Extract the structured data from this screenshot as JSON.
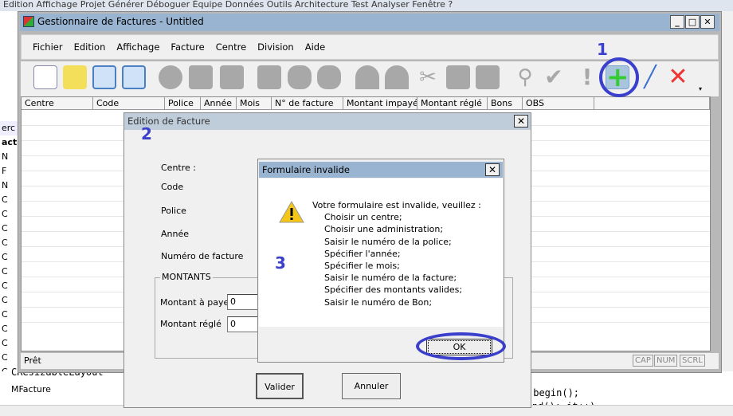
{
  "ide": {
    "top_menu": "Edition   Affichage   Projet   Générer   Déboguer   Équipe   Données   Outils   Architecture   Test   Analyser   Fenêtre   ?",
    "left_items": [
      "erc",
      "act",
      "N",
      "F",
      "N",
      "C",
      "C",
      "C",
      "C",
      "C",
      "C",
      "C",
      "C",
      "C",
      "C",
      "C",
      "C",
      "C"
    ],
    "tree_items": [
      "CResizableLayout",
      "MFacture"
    ],
    "code_lines": [
      ".begin();",
      "it!=DbDoc->m_listFacture.end(); it++)"
    ]
  },
  "main_window": {
    "title": "Gestionnaire de Factures - Untitled",
    "controls": {
      "minimize": "_",
      "maximize": "□",
      "close": "✕"
    },
    "menu": [
      "Fichier",
      "Edition",
      "Affichage",
      "Facture",
      "Centre",
      "Division",
      "Aide"
    ],
    "toolbar": [
      "new-document",
      "open-folder",
      "save",
      "save-as",
      "disabled",
      "disabled",
      "disabled",
      "disabled",
      "disabled",
      "disabled",
      "undo",
      "redo",
      "cut",
      "copy",
      "paste",
      "search",
      "check",
      "info",
      "add",
      "edit",
      "delete"
    ],
    "columns": [
      "Centre",
      "Code",
      "Police",
      "Année",
      "Mois",
      "N° de facture",
      "Montant impayé",
      "Montant réglé",
      "Bons",
      "OBS",
      ""
    ],
    "status": "Prêt",
    "indicators": [
      "CAP",
      "NUM",
      "SCRL"
    ]
  },
  "edit_dialog": {
    "title": "Edition de Facture",
    "fields": [
      "Centre :",
      "Code",
      "Police",
      "Année",
      "Numéro de facture"
    ],
    "group": "MONTANTS",
    "montant_a_payer_label": "Montant à payer",
    "montant_a_payer": "0",
    "montant_regle_label": "Montant réglé",
    "montant_regle": "0",
    "validate": "Valider",
    "cancel": "Annuler"
  },
  "message_box": {
    "title": "Formulaire invalide",
    "close": "✕",
    "icon": "warning-icon",
    "heading": "Votre formulaire est invalide, veuillez :",
    "items": [
      "Choisir un centre;",
      "Choisir une administration;",
      "Saisir le numéro de la police;",
      "Spécifier l'année;",
      "Spécifier le mois;",
      "Saisir le numéro de la facture;",
      "Spécifier des montants valides;",
      "Saisir le numéro de Bon;"
    ],
    "ok": "OK"
  },
  "annotations": {
    "one": "1",
    "two": "2",
    "three": "3",
    "color": "#3a3fcc"
  }
}
